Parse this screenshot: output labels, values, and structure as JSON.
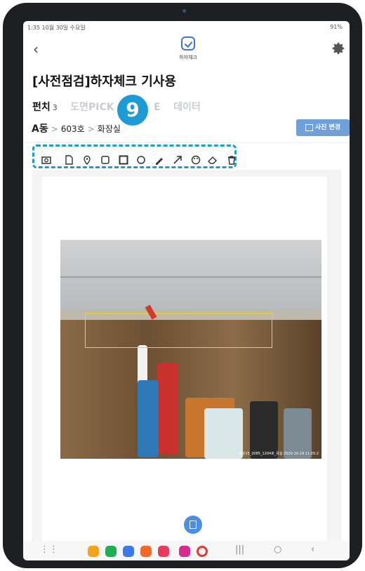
{
  "status_bar": {
    "time_date": "1:35  10월 30일 수요일",
    "right": "91%"
  },
  "app": {
    "name": "하자체크",
    "title": "[사전점검]하자체크 기사용"
  },
  "tabs": [
    {
      "label": "펀치",
      "count": "3",
      "active": true
    },
    {
      "label": "도면PICK",
      "active": false
    },
    {
      "label": "E",
      "active": false
    },
    {
      "label": "데이터",
      "active": false
    }
  ],
  "badge": "9",
  "breadcrumb": {
    "building": "A동",
    "unit": "603호",
    "room": "화장실"
  },
  "photo_change_button": "사진 변경",
  "toolbar": [
    "camera-icon",
    "file-icon",
    "pin-icon",
    "square-icon",
    "filled-square-icon",
    "circle-icon",
    "pen-icon",
    "arrow-icon",
    "palette-icon",
    "eraser-icon",
    "trash-icon"
  ],
  "photo_stamp": "관유15_2085_1204호_욕실 2020-10-19 11:05:2",
  "colors": {
    "accent": "#1c9bd6",
    "button": "#6fa0da",
    "selection": "#e8d23a"
  }
}
